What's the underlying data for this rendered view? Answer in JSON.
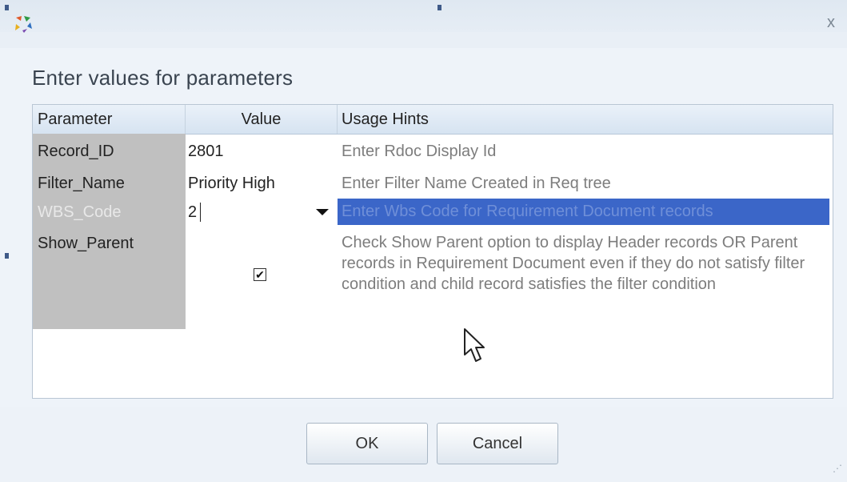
{
  "dialog": {
    "heading": "Enter values for parameters",
    "close_label": "x",
    "app_icon": "app-logo-icon"
  },
  "grid": {
    "columns": [
      "Parameter",
      "Value",
      "Usage Hints"
    ],
    "rows": [
      {
        "parameter": "Record_ID",
        "value": "2801",
        "hint": "Enter Rdoc Display Id"
      },
      {
        "parameter": "Filter_Name",
        "value": "Priority High",
        "hint": "Enter Filter Name Created in Req tree"
      },
      {
        "parameter": "WBS_Code",
        "value": "2",
        "hint": "Enter Wbs Code for Requirement Document records"
      },
      {
        "parameter": "Show_Parent",
        "value": "checked",
        "hint": "Check Show Parent option to display Header records OR Parent records in Requirement Document even if they do not satisfy filter condition and child record satisfies the filter condition"
      }
    ]
  },
  "buttons": {
    "ok": "OK",
    "cancel": "Cancel"
  },
  "colors": {
    "selection": "#3b66c8",
    "param_column": "#c0c0c0",
    "header_gradient_top": "#eaf1f9"
  }
}
